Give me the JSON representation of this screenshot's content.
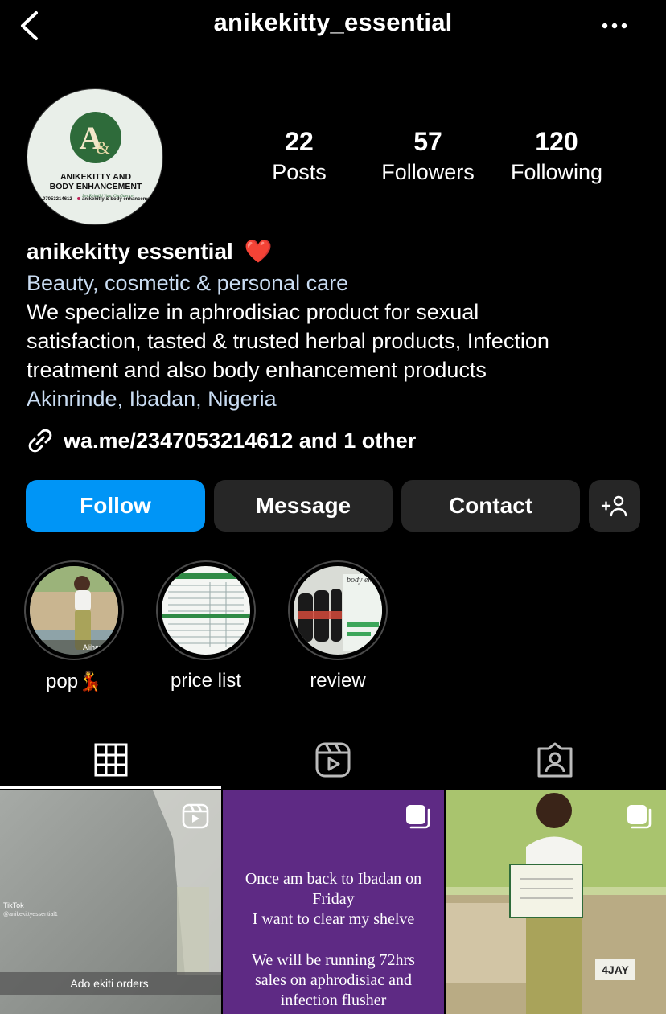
{
  "header": {
    "username": "anikekitty_essential",
    "back_icon": "chevron-left-icon",
    "more_icon": "more-horizontal-icon"
  },
  "avatar": {
    "logo_letter": "A",
    "brand_line1": "ANIKEKITTY AND",
    "brand_line2": "BODY ENHANCEMENT",
    "tagline": "Let Rebuild Your Confidence",
    "phone": "07053214612",
    "handle": "anikekitty & body enhancement"
  },
  "stats": [
    {
      "value": "22",
      "label": "Posts"
    },
    {
      "value": "57",
      "label": "Followers"
    },
    {
      "value": "120",
      "label": "Following"
    }
  ],
  "profile": {
    "display_name": "anikekitty essential",
    "name_emoji": "❤️",
    "category": "Beauty, cosmetic & personal care",
    "bio_line1": "We specialize in aphrodisiac product for sexual",
    "bio_line2": "satisfaction, tasted & trusted herbal products, Infection",
    "bio_line3": "treatment and also body enhancement products",
    "location": "Akinrinde, Ibadan, Nigeria",
    "link": "wa.me/2347053214612 and 1 other"
  },
  "actions": {
    "follow": "Follow",
    "message": "Message",
    "contact": "Contact",
    "add_user_icon": "add-user-icon"
  },
  "highlights": [
    {
      "label": "pop💃",
      "thumb_text": "Alihamdull"
    },
    {
      "label": "price list"
    },
    {
      "label": "review",
      "thumb_text": "body enh"
    }
  ],
  "tabs": [
    {
      "icon": "grid-icon",
      "active": true
    },
    {
      "icon": "reels-icon",
      "active": false
    },
    {
      "icon": "tagged-icon",
      "active": false
    }
  ],
  "posts": [
    {
      "type": "reel",
      "tiktok_label": "TikTok",
      "tiktok_handle": "@anikekittyessential1",
      "caption": "Ado ekiti orders"
    },
    {
      "type": "carousel",
      "text_line1": "Once am back to Ibadan on",
      "text_line2": "Friday",
      "text_line3": "I want to clear my shelve",
      "text_line4": "We will be running 72hrs",
      "text_line5": "sales  on aphrodisiac and",
      "text_line6": "infection flusher",
      "bg_color": "#5e2a84"
    },
    {
      "type": "carousel",
      "plate_text": "4JAY"
    }
  ],
  "colors": {
    "background": "#000000",
    "primary_button": "#0095f6",
    "secondary_button": "#262626",
    "link_blue": "#c9dcf2"
  }
}
